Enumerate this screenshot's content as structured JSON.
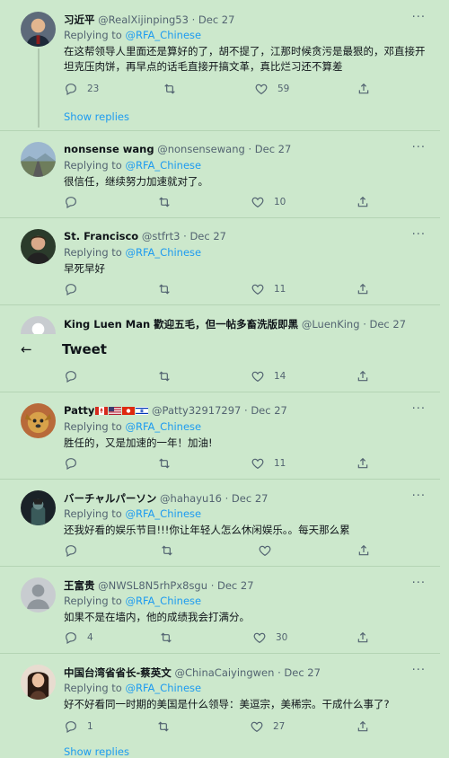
{
  "top_bar": {
    "back_icon": "←",
    "title": "Tweet"
  },
  "tweets": [
    {
      "name": "习近平",
      "handle": "@RealXijinping53",
      "date": "· Dec 27",
      "replying_prefix": "Replying to ",
      "replying_to": "@RFA_Chinese",
      "text": "在这帮领导人里面还是算好的了，胡不提了，江那时候贪污是最狠的，邓直接开坦克压肉饼，再早点的话毛直接开搞文革，真比烂习还不算差",
      "replies": "23",
      "retweets": "",
      "likes": "59",
      "show_replies": "Show replies"
    },
    {
      "name": "nonsense wang",
      "handle": "@nonsensewang",
      "date": "· Dec 27",
      "replying_prefix": "Replying to ",
      "replying_to": "@RFA_Chinese",
      "text": "很信任，继续努力加速就对了。",
      "replies": "",
      "retweets": "",
      "likes": "10"
    },
    {
      "name": "St. Francisco",
      "handle": "@stfrt3",
      "date": "· Dec 27",
      "replying_prefix": "Replying to ",
      "replying_to": "@RFA_Chinese",
      "text": "早死早好",
      "replies": "",
      "retweets": "",
      "likes": "11"
    },
    {
      "name": "King Luen Man 歡迎五毛，但一帖多畜洗版即黑",
      "handle": "@LuenKing",
      "date": "· Dec 27",
      "replies": "",
      "retweets": "",
      "likes": "14"
    },
    {
      "name": "Patty",
      "handle": "@Patty32917297",
      "date": "· Dec 27",
      "replying_prefix": "Replying to ",
      "replying_to": "@RFA_Chinese",
      "text": "胜任的，又是加速的一年！加油!",
      "replies": "",
      "retweets": "",
      "likes": "11"
    },
    {
      "name": "バーチャルパーソン",
      "handle": "@hahayu16",
      "date": "· Dec 27",
      "replying_prefix": "Replying to ",
      "replying_to": "@RFA_Chinese",
      "text": "还我好看的娱乐节目!!!你让年轻人怎么休闲娱乐。。每天那么累",
      "replies": "",
      "retweets": "",
      "likes": ""
    },
    {
      "name": "王富贵",
      "handle": "@NWSL8N5rhPx8sgu",
      "date": "· Dec 27",
      "replying_prefix": "Replying to ",
      "replying_to": "@RFA_Chinese",
      "text": "如果不是在墙内，他的成绩我会打满分。",
      "replies": "4",
      "retweets": "",
      "likes": "30"
    },
    {
      "name": "中国台湾省省长-蔡英文",
      "handle": "@ChinaCaiyingwen",
      "date": "· Dec 27",
      "replying_prefix": "Replying to ",
      "replying_to": "@RFA_Chinese",
      "text": "好不好看同一时期的美国是什么领导：美逗宗，美稀宗。干成什么事了?",
      "replies": "1",
      "retweets": "",
      "likes": "27",
      "show_replies": "Show replies"
    }
  ],
  "more_icon": "···",
  "colors": {
    "background": "#cce8cc",
    "link": "#1d9bf0",
    "muted": "#536471"
  }
}
